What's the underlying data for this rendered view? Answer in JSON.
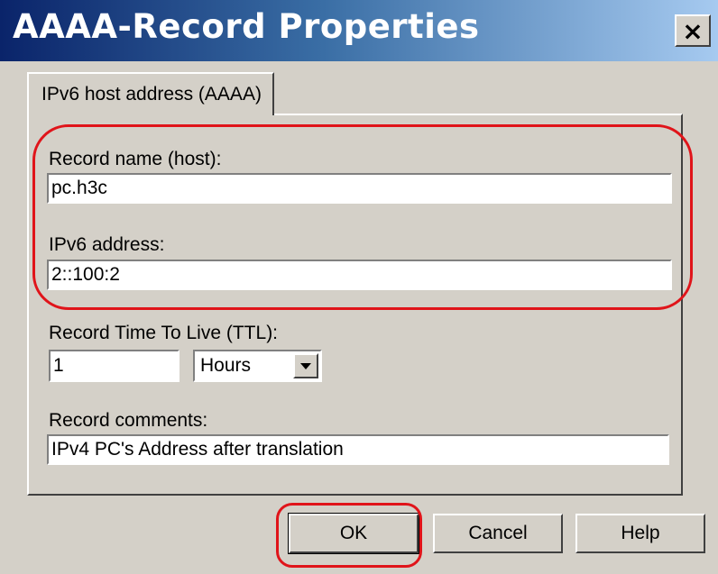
{
  "window": {
    "title": "AAAA-Record Properties",
    "close_symbol": "×"
  },
  "tab": {
    "label": "IPv6 host address (AAAA)"
  },
  "form": {
    "record_name_label": "Record name (host):",
    "record_name_value": "pc.h3c",
    "ipv6_label": "IPv6 address:",
    "ipv6_value": "2::100:2",
    "ttl_label": "Record Time To Live (TTL):",
    "ttl_value": "1",
    "ttl_unit": "Hours",
    "comments_label": "Record comments:",
    "comments_value": "IPv4 PC's Address after translation"
  },
  "buttons": {
    "ok": "OK",
    "cancel": "Cancel",
    "help": "Help"
  },
  "annotation": {
    "highlight_color": "#e0141a"
  }
}
